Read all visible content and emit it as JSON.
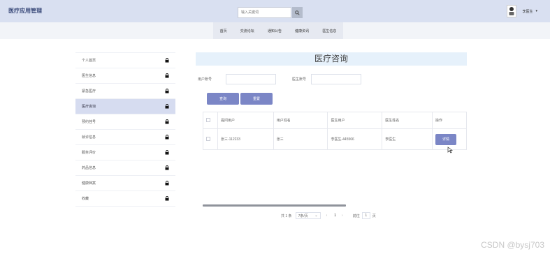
{
  "app": {
    "title": "医疗应用管理"
  },
  "search": {
    "placeholder": "输入关键词"
  },
  "user": {
    "name": "李医生"
  },
  "top_nav": {
    "items": [
      "首页",
      "交流论坛",
      "通知公告",
      "健康资讯",
      "医生信息"
    ]
  },
  "sidebar": {
    "items": [
      {
        "label": "个人首页"
      },
      {
        "label": "医生信息"
      },
      {
        "label": "紧急医疗"
      },
      {
        "label": "医疗咨询",
        "active": true
      },
      {
        "label": "预约挂号"
      },
      {
        "label": "就诊信息"
      },
      {
        "label": "服务评价"
      },
      {
        "label": "药品信息"
      },
      {
        "label": "健康档案"
      },
      {
        "label": "收藏"
      }
    ]
  },
  "main": {
    "title": "医疗咨询",
    "filters": {
      "user_account_label": "用户账号",
      "doctor_account_label": "医生账号"
    },
    "buttons": {
      "query": "查询",
      "reset": "重置"
    },
    "table": {
      "headers": [
        "提问用户",
        "用户姓名",
        "医生用户",
        "医生姓名",
        "操作"
      ],
      "rows": [
        {
          "asker": "张三-112233",
          "user_name": "张三",
          "doctor_user": "李医生-445566",
          "doctor_name": "李医生",
          "action": "详情"
        }
      ]
    },
    "pagination": {
      "total": "共 1 条",
      "page_size": "7条/页",
      "prev": "‹",
      "current": "1",
      "next": "›",
      "goto_label": "前往",
      "goto_value": "1",
      "page_suffix": "页"
    }
  },
  "watermark": "CSDN @bysj703",
  "colors": {
    "topbar": "#d9e0f1",
    "accent": "#7b86c6",
    "active_side": "#d6dcf0",
    "title_bg": "#e6f1fb"
  }
}
